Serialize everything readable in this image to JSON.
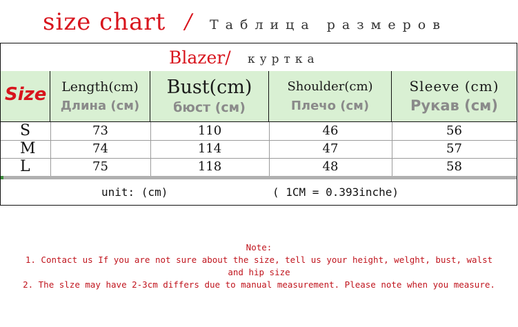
{
  "header": {
    "title": "size chart",
    "slash": "/",
    "title_ru": "Таблица размеров"
  },
  "garment": {
    "name_en": "Blazer/",
    "name_ru": "куртка"
  },
  "columns": {
    "size_label": "Size",
    "headers": [
      {
        "en": "Length(cm)",
        "ru": "Длина (см)"
      },
      {
        "en": "Bust(cm)",
        "ru": "бюст (см)"
      },
      {
        "en": "Shoulder(cm)",
        "ru": "Плечо (см)"
      },
      {
        "en": "Sleeve (cm)",
        "ru": "Рукав (см)"
      }
    ]
  },
  "rows": [
    {
      "size": "S",
      "values": [
        "73",
        "110",
        "46",
        "56"
      ]
    },
    {
      "size": "M",
      "values": [
        "74",
        "114",
        "47",
        "57"
      ]
    },
    {
      "size": "L",
      "values": [
        "75",
        "118",
        "48",
        "58"
      ]
    }
  ],
  "unit": {
    "label": "unit: (cm)",
    "conversion": "( 1CM = 0.393inche)"
  },
  "notes": {
    "title": "Note:",
    "line1a": "1. Contact us If you are not sure about the size, tell us your height, welght, bust, walst",
    "line1b": "and hip size",
    "line2": "2. The slze may have 2-3cm differs due to manual measurement. Please note when you measure."
  },
  "colors": {
    "accent_red": "#d8141d",
    "header_green": "#d9f0d3",
    "russian_gray": "#8a8a8a"
  }
}
